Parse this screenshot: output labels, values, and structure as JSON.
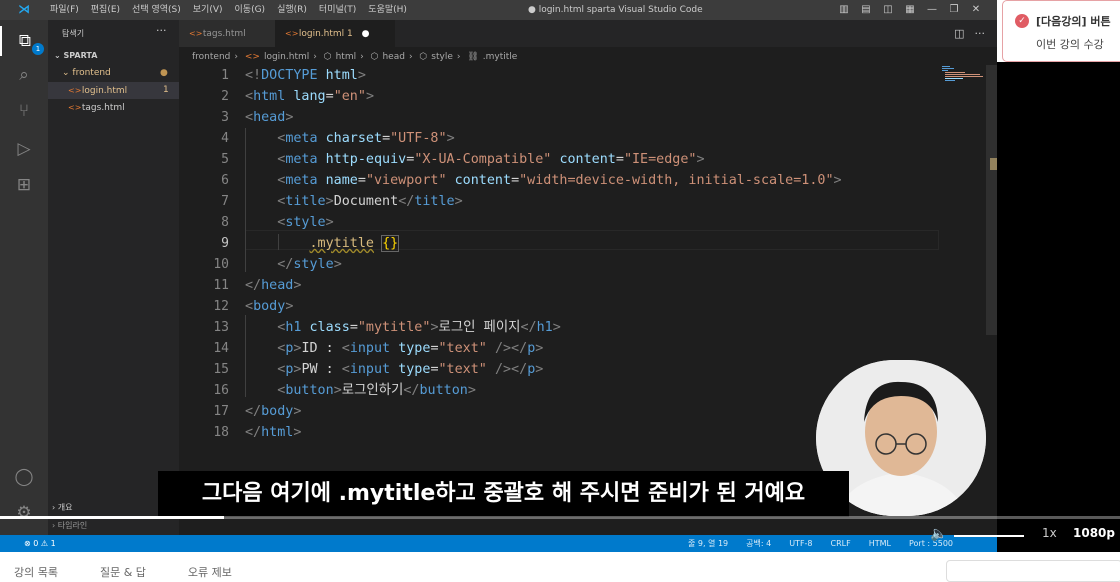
{
  "titlebar": {
    "menu": [
      "파일(F)",
      "편집(E)",
      "선택 영역(S)",
      "보기(V)",
      "이동(G)",
      "실행(R)",
      "터미널(T)",
      "도움말(H)"
    ],
    "title": "● login.html   sparta   Visual Studio Code"
  },
  "activity": {
    "badge": "1"
  },
  "sidebar": {
    "header": "탐색기",
    "workspace": "SPARTA",
    "folder": "frontend",
    "files": [
      {
        "name": "login.html",
        "count": "1"
      },
      {
        "name": "tags.html",
        "count": ""
      }
    ],
    "outline": "개요",
    "timeline": "타임라인"
  },
  "tabs": [
    {
      "label": "tags.html"
    },
    {
      "label": "login.html 1"
    }
  ],
  "breadcrumb": [
    "frontend",
    "login.html",
    "html",
    "head",
    "style",
    ".mytitle"
  ],
  "editor": {
    "current_line": 9,
    "lines": [
      "1",
      "2",
      "3",
      "4",
      "5",
      "6",
      "7",
      "8",
      "9",
      "10",
      "11",
      "12",
      "13",
      "14",
      "15",
      "16",
      "17",
      "18"
    ]
  },
  "statusbar": {
    "left": "⊗ 0 ⚠ 1",
    "items": [
      "줄 9, 열 19",
      "공백: 4",
      "UTF-8",
      "CRLF",
      "HTML",
      "Port : 5500"
    ]
  },
  "notification": {
    "title": "[다음강의] 버튼",
    "body": "이번 강의 수강"
  },
  "video": {
    "subtitle": "그다음 여기에 .mytitle하고 중괄호 해 주시면 준비가 된 거예요",
    "speed": "1x",
    "quality": "1080p",
    "progress": 0.2
  },
  "bottom": {
    "tabs": [
      "강의 목록",
      "질문 & 답",
      "오류 제보"
    ]
  },
  "colors": {
    "accent": "#007acc",
    "tag": "#569cd6",
    "attr": "#9cdcfe",
    "value": "#ce9178"
  }
}
